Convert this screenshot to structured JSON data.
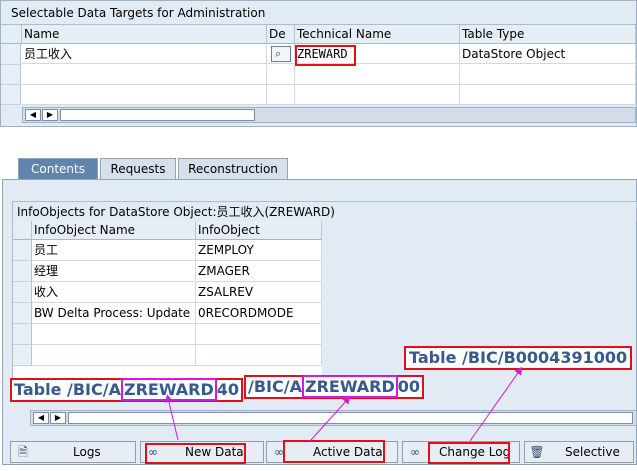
{
  "top": {
    "title": "Selectable Data Targets for Administration",
    "columns": [
      "Name",
      "De",
      "Technical Name",
      "Table Type"
    ],
    "rows": [
      {
        "name": "员工收入",
        "technical_name": "ZREWARD",
        "table_type": "DataStore Object"
      }
    ]
  },
  "tabs": [
    {
      "label": "Contents"
    },
    {
      "label": "Requests"
    },
    {
      "label": "Reconstruction"
    }
  ],
  "info": {
    "title": "InfoObjects for DataStore Object:员工收入(ZREWARD)",
    "columns": [
      "InfoObject Name",
      "InfoObject"
    ],
    "rows": [
      {
        "name": "员工",
        "obj": "ZEMPLOY"
      },
      {
        "name": "经理",
        "obj": "ZMAGER"
      },
      {
        "name": "收入",
        "obj": "ZSALREV"
      },
      {
        "name": "BW Delta Process: Update M...",
        "obj": "0RECORDMODE"
      }
    ]
  },
  "buttons": {
    "logs": "Logs",
    "new_data": "New Data",
    "active_data": "Active Data",
    "change_log": "Change Log",
    "selective": "Selective"
  },
  "annotations": {
    "new_table_prefix": "Table /BIC/A",
    "new_table_name": "ZREWARD",
    "new_table_suffix": "40",
    "active_table_prefix": "/BIC/A",
    "active_table_name": "ZREWARD",
    "active_table_suffix": "00",
    "change_log_table": "Table /BIC/B0004391000"
  },
  "colors": {
    "annotation_text": "#365a8c",
    "highlight_red": "#e0101a",
    "highlight_magenta": "#d01adc",
    "active_tab": "#5f85ad"
  }
}
